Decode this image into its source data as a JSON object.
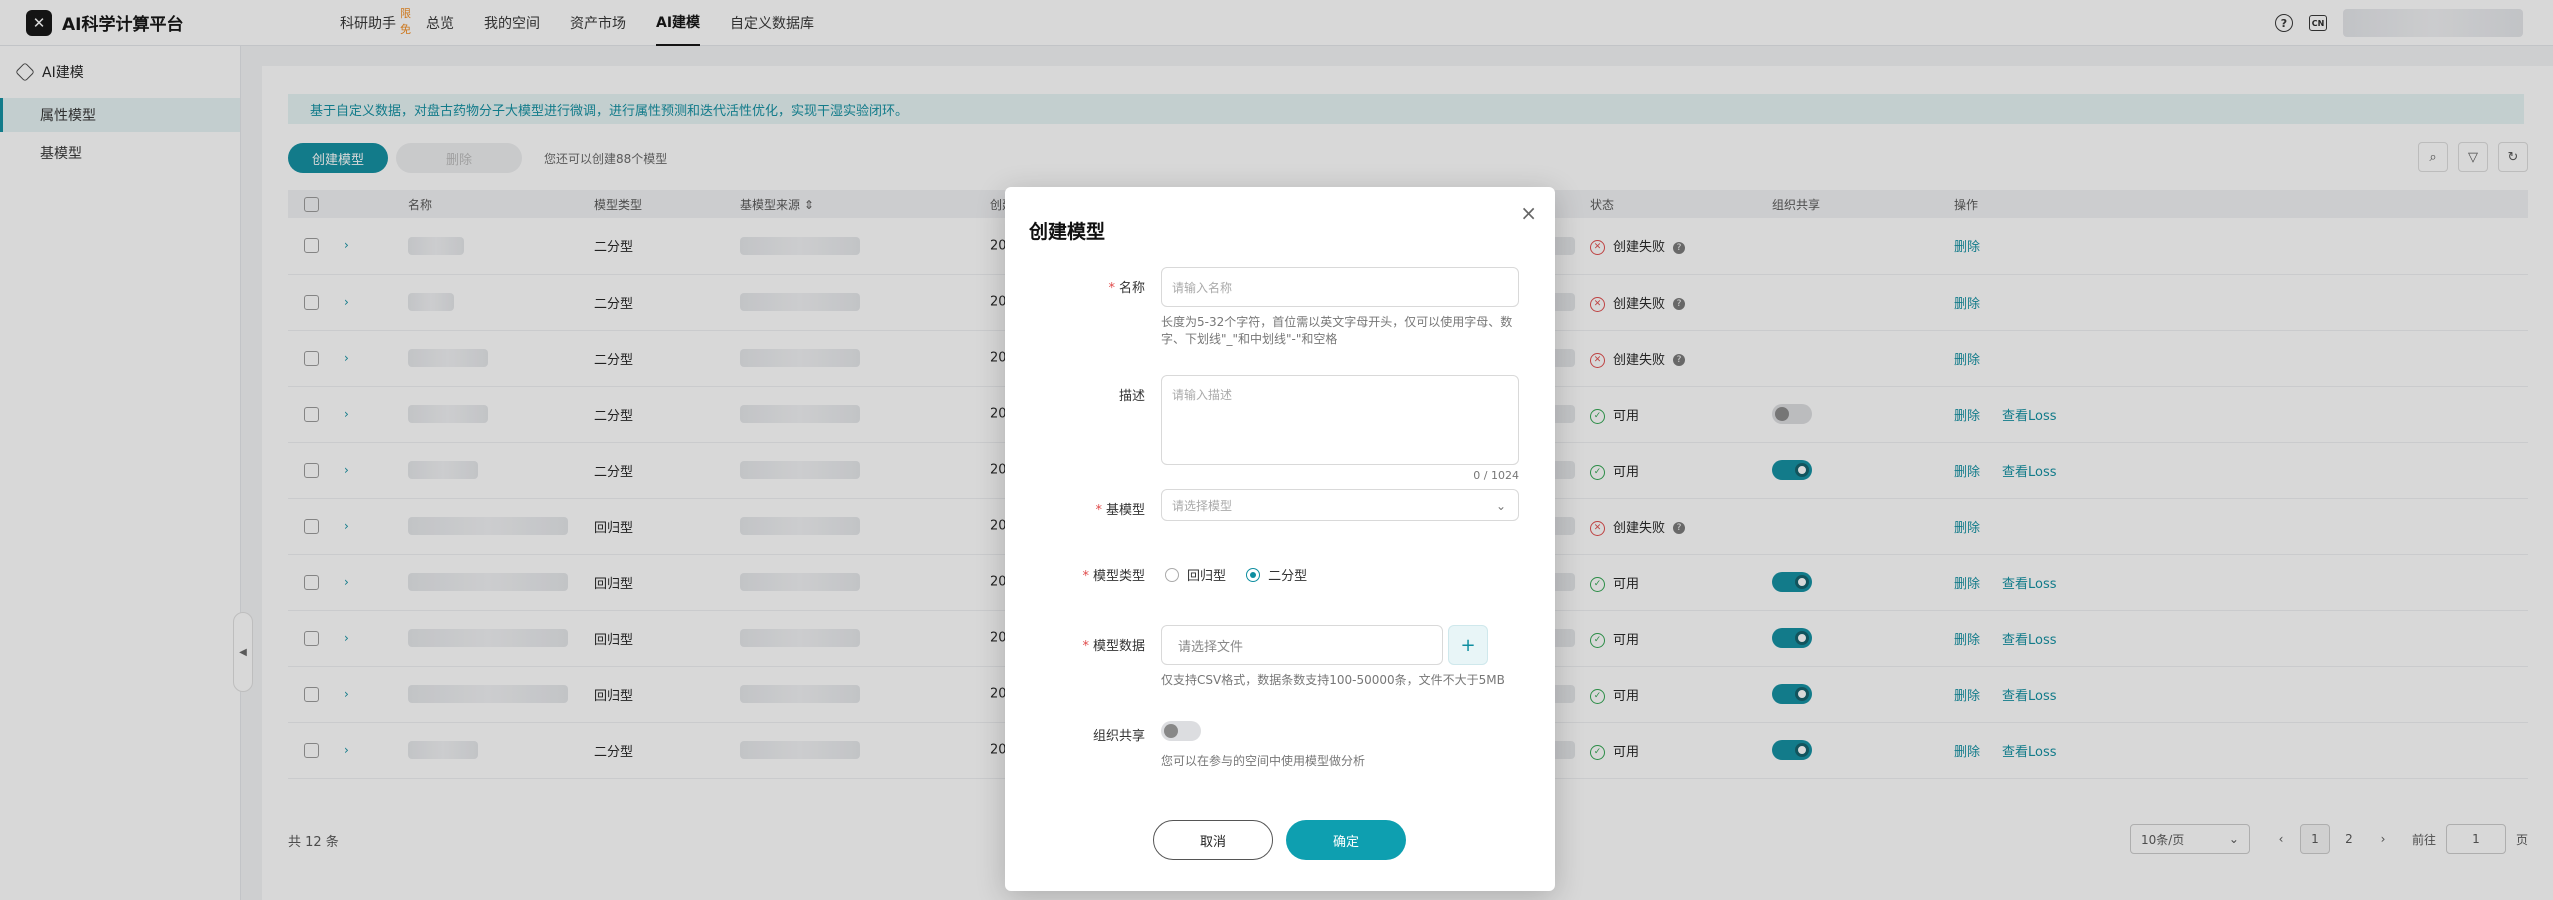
{
  "app": {
    "title": "AI科学计算平台"
  },
  "nav": {
    "items": [
      {
        "label": "科研助手",
        "badge": "限免"
      },
      {
        "label": "总览"
      },
      {
        "label": "我的空间"
      },
      {
        "label": "资产市场"
      },
      {
        "label": "AI建模",
        "active": true
      },
      {
        "label": "自定义数据库"
      }
    ],
    "help_icon": "help-icon",
    "lang_label": "CN"
  },
  "sidebar": {
    "group_label": "AI建模",
    "items": [
      {
        "label": "属性模型",
        "active": true
      },
      {
        "label": "基模型"
      }
    ]
  },
  "main": {
    "info": "基于自定义数据，对盘古药物分子大模型进行微调，进行属性预测和迭代活性优化，实现干湿实验闭环。",
    "create_label": "创建模型",
    "delete_label": "删除",
    "quota": "您还可以创建88个模型",
    "columns": {
      "name": "名称",
      "type": "模型类型",
      "source": "基模型来源",
      "created": "创建",
      "status": "状态",
      "share": "组织共享",
      "ops": "操作"
    },
    "rows": [
      {
        "type": "二分型",
        "year": "202",
        "status": "创建失败",
        "ok": false,
        "share": null,
        "ops": [
          "删除"
        ]
      },
      {
        "type": "二分型",
        "year": "202",
        "status": "创建失败",
        "ok": false,
        "share": null,
        "ops": [
          "删除"
        ]
      },
      {
        "type": "二分型",
        "year": "202",
        "status": "创建失败",
        "ok": false,
        "share": null,
        "ops": [
          "删除"
        ]
      },
      {
        "type": "二分型",
        "year": "202",
        "status": "可用",
        "ok": true,
        "share": "off",
        "ops": [
          "删除",
          "查看Loss"
        ]
      },
      {
        "type": "二分型",
        "year": "202",
        "status": "可用",
        "ok": true,
        "share": "on",
        "ops": [
          "删除",
          "查看Loss"
        ]
      },
      {
        "type": "回归型",
        "year": "202",
        "status": "创建失败",
        "ok": false,
        "share": null,
        "ops": [
          "删除"
        ]
      },
      {
        "type": "回归型",
        "year": "202",
        "status": "可用",
        "ok": true,
        "share": "on",
        "ops": [
          "删除",
          "查看Loss"
        ]
      },
      {
        "type": "回归型",
        "year": "202",
        "status": "可用",
        "ok": true,
        "share": "on",
        "ops": [
          "删除",
          "查看Loss"
        ]
      },
      {
        "type": "回归型",
        "year": "202",
        "status": "可用",
        "ok": true,
        "share": "on",
        "ops": [
          "删除",
          "查看Loss"
        ]
      },
      {
        "type": "二分型",
        "year": "202",
        "status": "可用",
        "ok": true,
        "share": "on",
        "ops": [
          "删除",
          "查看Loss"
        ]
      }
    ],
    "total": "共 12 条",
    "page_size": "10条/页",
    "pages": [
      "1",
      "2"
    ],
    "current_page": "1",
    "goto_label": "前往",
    "goto_value": "1",
    "page_suffix": "页"
  },
  "modal": {
    "title": "创建模型",
    "name_label": "名称",
    "name_placeholder": "请输入名称",
    "name_help": "长度为5-32个字符，首位需以英文字母开头，仅可以使用字母、数字、下划线\"_\"和中划线\"-\"和空格",
    "desc_label": "描述",
    "desc_placeholder": "请输入描述",
    "desc_counter": "0 / 1024",
    "base_label": "基模型",
    "base_placeholder": "请选择模型",
    "type_label": "模型类型",
    "type_options": [
      "回归型",
      "二分型"
    ],
    "type_selected": "二分型",
    "data_label": "模型数据",
    "data_placeholder": "请选择文件",
    "data_help": "仅支持CSV格式，数据条数支持100-50000条，文件不大于5MB",
    "share_label": "组织共享",
    "share_help": "您可以在参与的空间中使用模型做分析",
    "cancel_label": "取消",
    "ok_label": "确定"
  },
  "colors": {
    "accent": "#0e8ea0",
    "error": "#e04a4a",
    "success": "#2ea44f"
  }
}
